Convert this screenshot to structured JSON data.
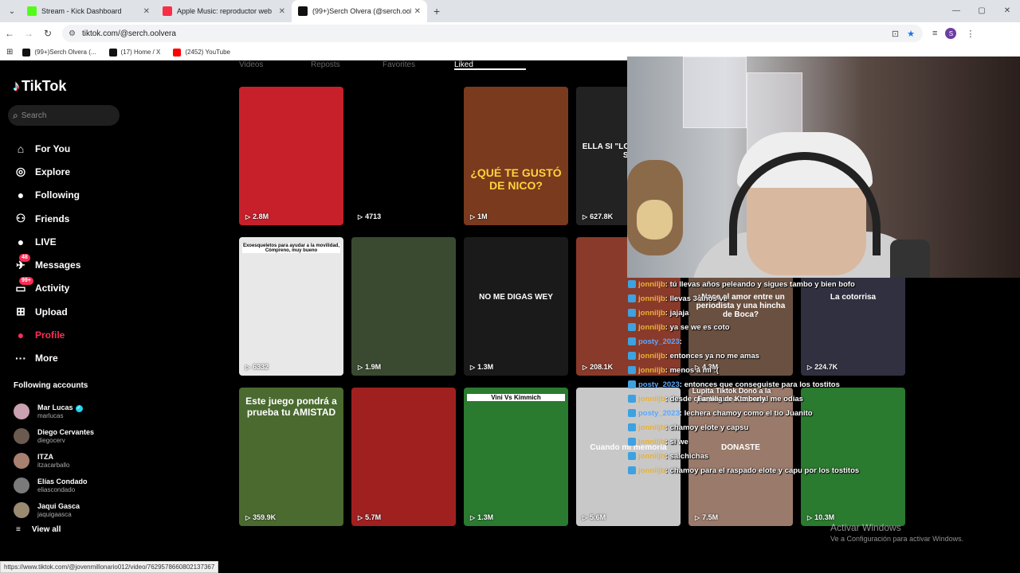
{
  "browser": {
    "tabs": [
      {
        "title": "Stream - Kick Dashboard",
        "color": "#53fc18",
        "active": false
      },
      {
        "title": "Apple Music: reproductor web",
        "color": "#fa2d48",
        "active": false
      },
      {
        "title": "(99+)Serch Olvera (@serch.oolv",
        "color": "#111111",
        "active": true
      }
    ],
    "new_tab": "+",
    "url": "tiktok.com/@serch.oolvera",
    "bookmarks": [
      {
        "title": "(99+)Serch Olvera (...",
        "color": "#111111"
      },
      {
        "title": "(17) Home / X",
        "color": "#111111"
      },
      {
        "title": "(2452) YouTube",
        "color": "#ff0000"
      }
    ],
    "profile_initial": "S",
    "status_url": "https://www.tiktok.com/@jovenmillonario012/video/7629578660802137367"
  },
  "tiktok": {
    "logo": "TikTok",
    "search_placeholder": "Search",
    "nav": [
      {
        "label": "For You",
        "icon": "home-icon",
        "glyph": "⌂",
        "badge": ""
      },
      {
        "label": "Explore",
        "icon": "compass-icon",
        "glyph": "◎",
        "badge": ""
      },
      {
        "label": "Following",
        "icon": "following-avatar-icon",
        "glyph": "●",
        "badge": ""
      },
      {
        "label": "Friends",
        "icon": "friends-icon",
        "glyph": "⚇",
        "badge": ""
      },
      {
        "label": "LIVE",
        "icon": "live-icon",
        "glyph": "●",
        "badge": ""
      },
      {
        "label": "Messages",
        "icon": "messages-icon",
        "glyph": "✈",
        "badge": "48"
      },
      {
        "label": "Activity",
        "icon": "activity-icon",
        "glyph": "▭",
        "badge": "99+"
      },
      {
        "label": "Upload",
        "icon": "upload-icon",
        "glyph": "⊞",
        "badge": ""
      },
      {
        "label": "Profile",
        "icon": "profile-icon",
        "glyph": "●",
        "badge": "",
        "active": true
      },
      {
        "label": "More",
        "icon": "more-icon",
        "glyph": "···",
        "badge": ""
      }
    ],
    "following_title": "Following accounts",
    "following": [
      {
        "name": "Mar Lucas",
        "handle": "marlucas",
        "verified": true,
        "color": "#c9a1b0"
      },
      {
        "name": "Diego Cervantes",
        "handle": "diegocerv",
        "verified": false,
        "color": "#6a5a50"
      },
      {
        "name": "ITZA",
        "handle": "itzacarballo",
        "verified": false,
        "color": "#a88070"
      },
      {
        "name": "Elías Condado",
        "handle": "eliascondado",
        "verified": false,
        "color": "#7a7a7a"
      },
      {
        "name": "Jaqui Gasca",
        "handle": "jaquigaasca",
        "verified": false,
        "color": "#9a8a70"
      }
    ],
    "view_all": "View all",
    "profile_tabs": [
      "Videos",
      "Reposts",
      "Favorites",
      "Liked"
    ]
  },
  "videos": [
    {
      "views": "2.8M",
      "caption": "",
      "bg": "#c8202a"
    },
    {
      "views": "4713",
      "caption": "",
      "bg": "#000000"
    },
    {
      "views": "1M",
      "caption": "¿QUÉ TE GUSTÓ DE NICO?",
      "bg": "#7a3a1e"
    },
    {
      "views": "627.8K",
      "caption": "ELLA SI \"LO D PORQUE SE",
      "bg": "#222222"
    },
    {
      "views": "6332",
      "caption": "Exoesqueletos para ayudar a la movilidad, Cómpreno, muy bueno",
      "bg": "#e8e8e8"
    },
    {
      "views": "1.9M",
      "caption": "",
      "bg": "#3a4a30"
    },
    {
      "views": "1.3M",
      "caption": "NO ME DIGAS WEY",
      "bg": "#1a1a1a"
    },
    {
      "views": "208.1K",
      "caption": "",
      "bg": "#8a3a2a"
    },
    {
      "views": "4.3M",
      "caption": "¿Nace el amor entre un periodista y una hincha de Boca?",
      "bg": "#6a5040"
    },
    {
      "views": "224.7K",
      "caption": "La cotorrisa",
      "bg": "#303040"
    },
    {
      "views": "359.9K",
      "caption": "Este juego pondrá a prueba tu AMISTAD",
      "bg": "#4a6a30"
    },
    {
      "views": "5.7M",
      "caption": "",
      "bg": "#a02020"
    },
    {
      "views": "1.3M",
      "caption": "Vini Vs Kimmich",
      "bg": "#2a7a30"
    },
    {
      "views": "5.6M",
      "caption": "Cuando mi memoria",
      "bg": "#c8c8c8"
    },
    {
      "views": "7.5M",
      "caption": "DONASTE",
      "bg": "#9a7a6a"
    },
    {
      "views": "10.3M",
      "caption": "",
      "bg": "#2a7a30"
    }
  ],
  "chat": [
    {
      "user": "jonniljb",
      "msg": ": tú llevas años peleando y sigues tambo y bien bofo",
      "p": false
    },
    {
      "user": "jonniljb",
      "msg": ": llevas 3 años ve",
      "p": false
    },
    {
      "user": "jonniljb",
      "msg": ": jajaja",
      "p": false
    },
    {
      "user": "jonniljb",
      "msg": ": ya se we es coto",
      "p": false
    },
    {
      "user": "posty_2023",
      "msg": ":",
      "p": true
    },
    {
      "user": "jonniljb",
      "msg": ": entonces ya no me amas",
      "p": false
    },
    {
      "user": "jonniljb",
      "msg": ": menos a mi :(",
      "p": false
    },
    {
      "user": "posty_2023",
      "msg": ": entonces que conseguiste para los tostitos",
      "p": true
    },
    {
      "user": "jonniljb",
      "msg": ": desde que llegue a tu canal me odias",
      "p": false
    },
    {
      "user": "posty_2023",
      "msg": ": lechera chamoy como el tio Juanito",
      "p": true
    },
    {
      "user": "jonniljb",
      "msg": ": chamoy elote y capsu",
      "p": false
    },
    {
      "user": "jonniljb",
      "msg": ": si we",
      "p": false
    },
    {
      "user": "jonniljb",
      "msg": ": salchichas",
      "p": false
    },
    {
      "user": "jonniljb",
      "msg": ": chamoy para el raspado elote y capu por los tostitos",
      "p": false
    }
  ],
  "donation": "Lupita Tiktok Donó a la Familia de Kimberly",
  "windows_watermark": {
    "line1": "Activar Windows",
    "line2": "Ve a Configuración para activar Windows."
  }
}
